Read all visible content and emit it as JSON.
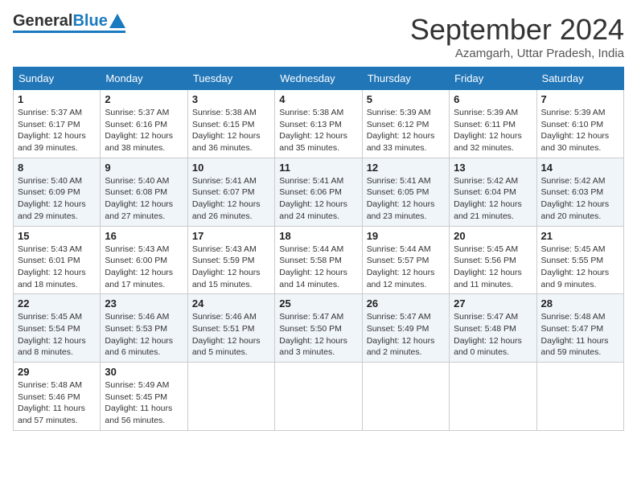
{
  "header": {
    "logo_general": "General",
    "logo_blue": "Blue",
    "month_title": "September 2024",
    "subtitle": "Azamgarh, Uttar Pradesh, India"
  },
  "days_of_week": [
    "Sunday",
    "Monday",
    "Tuesday",
    "Wednesday",
    "Thursday",
    "Friday",
    "Saturday"
  ],
  "weeks": [
    [
      {
        "day": "1",
        "sunrise": "5:37 AM",
        "sunset": "6:17 PM",
        "daylight": "12 hours and 39 minutes."
      },
      {
        "day": "2",
        "sunrise": "5:37 AM",
        "sunset": "6:16 PM",
        "daylight": "12 hours and 38 minutes."
      },
      {
        "day": "3",
        "sunrise": "5:38 AM",
        "sunset": "6:15 PM",
        "daylight": "12 hours and 36 minutes."
      },
      {
        "day": "4",
        "sunrise": "5:38 AM",
        "sunset": "6:13 PM",
        "daylight": "12 hours and 35 minutes."
      },
      {
        "day": "5",
        "sunrise": "5:39 AM",
        "sunset": "6:12 PM",
        "daylight": "12 hours and 33 minutes."
      },
      {
        "day": "6",
        "sunrise": "5:39 AM",
        "sunset": "6:11 PM",
        "daylight": "12 hours and 32 minutes."
      },
      {
        "day": "7",
        "sunrise": "5:39 AM",
        "sunset": "6:10 PM",
        "daylight": "12 hours and 30 minutes."
      }
    ],
    [
      {
        "day": "8",
        "sunrise": "5:40 AM",
        "sunset": "6:09 PM",
        "daylight": "12 hours and 29 minutes."
      },
      {
        "day": "9",
        "sunrise": "5:40 AM",
        "sunset": "6:08 PM",
        "daylight": "12 hours and 27 minutes."
      },
      {
        "day": "10",
        "sunrise": "5:41 AM",
        "sunset": "6:07 PM",
        "daylight": "12 hours and 26 minutes."
      },
      {
        "day": "11",
        "sunrise": "5:41 AM",
        "sunset": "6:06 PM",
        "daylight": "12 hours and 24 minutes."
      },
      {
        "day": "12",
        "sunrise": "5:41 AM",
        "sunset": "6:05 PM",
        "daylight": "12 hours and 23 minutes."
      },
      {
        "day": "13",
        "sunrise": "5:42 AM",
        "sunset": "6:04 PM",
        "daylight": "12 hours and 21 minutes."
      },
      {
        "day": "14",
        "sunrise": "5:42 AM",
        "sunset": "6:03 PM",
        "daylight": "12 hours and 20 minutes."
      }
    ],
    [
      {
        "day": "15",
        "sunrise": "5:43 AM",
        "sunset": "6:01 PM",
        "daylight": "12 hours and 18 minutes."
      },
      {
        "day": "16",
        "sunrise": "5:43 AM",
        "sunset": "6:00 PM",
        "daylight": "12 hours and 17 minutes."
      },
      {
        "day": "17",
        "sunrise": "5:43 AM",
        "sunset": "5:59 PM",
        "daylight": "12 hours and 15 minutes."
      },
      {
        "day": "18",
        "sunrise": "5:44 AM",
        "sunset": "5:58 PM",
        "daylight": "12 hours and 14 minutes."
      },
      {
        "day": "19",
        "sunrise": "5:44 AM",
        "sunset": "5:57 PM",
        "daylight": "12 hours and 12 minutes."
      },
      {
        "day": "20",
        "sunrise": "5:45 AM",
        "sunset": "5:56 PM",
        "daylight": "12 hours and 11 minutes."
      },
      {
        "day": "21",
        "sunrise": "5:45 AM",
        "sunset": "5:55 PM",
        "daylight": "12 hours and 9 minutes."
      }
    ],
    [
      {
        "day": "22",
        "sunrise": "5:45 AM",
        "sunset": "5:54 PM",
        "daylight": "12 hours and 8 minutes."
      },
      {
        "day": "23",
        "sunrise": "5:46 AM",
        "sunset": "5:53 PM",
        "daylight": "12 hours and 6 minutes."
      },
      {
        "day": "24",
        "sunrise": "5:46 AM",
        "sunset": "5:51 PM",
        "daylight": "12 hours and 5 minutes."
      },
      {
        "day": "25",
        "sunrise": "5:47 AM",
        "sunset": "5:50 PM",
        "daylight": "12 hours and 3 minutes."
      },
      {
        "day": "26",
        "sunrise": "5:47 AM",
        "sunset": "5:49 PM",
        "daylight": "12 hours and 2 minutes."
      },
      {
        "day": "27",
        "sunrise": "5:47 AM",
        "sunset": "5:48 PM",
        "daylight": "12 hours and 0 minutes."
      },
      {
        "day": "28",
        "sunrise": "5:48 AM",
        "sunset": "5:47 PM",
        "daylight": "11 hours and 59 minutes."
      }
    ],
    [
      {
        "day": "29",
        "sunrise": "5:48 AM",
        "sunset": "5:46 PM",
        "daylight": "11 hours and 57 minutes."
      },
      {
        "day": "30",
        "sunrise": "5:49 AM",
        "sunset": "5:45 PM",
        "daylight": "11 hours and 56 minutes."
      },
      null,
      null,
      null,
      null,
      null
    ]
  ],
  "labels": {
    "sunrise": "Sunrise:",
    "sunset": "Sunset:",
    "daylight": "Daylight:"
  }
}
